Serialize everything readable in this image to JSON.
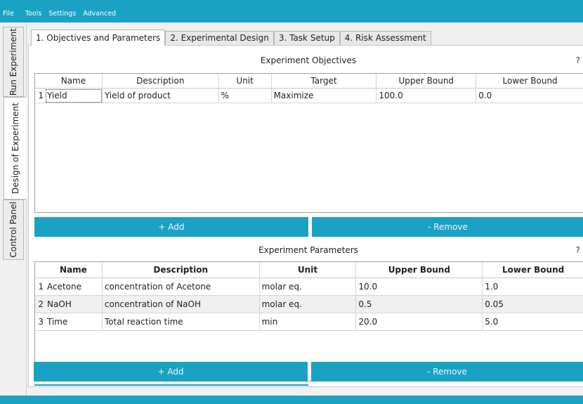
{
  "menu": {
    "items": [
      "File",
      "Tools",
      "Settings",
      "Advanced"
    ]
  },
  "side_tabs": [
    "Run Experiment",
    "Design of Experiment",
    "Control Panel"
  ],
  "top_tabs": [
    "1. Objectives and Parameters",
    "2. Experimental Design",
    "3. Task Setup",
    "4. Risk Assessment"
  ],
  "objectives": {
    "title": "Experiment Objectives",
    "help": "?",
    "columns": [
      "Name",
      "Description",
      "Unit",
      "Target",
      "Upper Bound",
      "Lower Bound"
    ],
    "rows": [
      {
        "num": "1",
        "cells": [
          "Yield",
          "Yield of product",
          "%",
          "Maximize",
          "100.0",
          "0.0"
        ]
      }
    ],
    "add_label": "+ Add",
    "remove_label": "- Remove"
  },
  "parameters": {
    "title": "Experiment Parameters",
    "help": "?",
    "columns": [
      "Name",
      "Description",
      "Unit",
      "Upper Bound",
      "Lower Bound"
    ],
    "rows": [
      {
        "num": "1",
        "cells": [
          "Acetone",
          "concentration of Acetone",
          "molar eq.",
          "10.0",
          "1.0"
        ]
      },
      {
        "num": "2",
        "cells": [
          "NaOH",
          "concentration of NaOH",
          "molar eq.",
          "0.5",
          "0.05"
        ]
      },
      {
        "num": "3",
        "cells": [
          "Time",
          "Total reaction time",
          "min",
          "20.0",
          "5.0"
        ]
      }
    ],
    "add_label": "+ Add",
    "remove_label": "- Remove"
  },
  "colors": {
    "accent": "#1aa2c4",
    "selected_row": "#f0f0f0",
    "selected_rownum": "#cde3f5"
  }
}
